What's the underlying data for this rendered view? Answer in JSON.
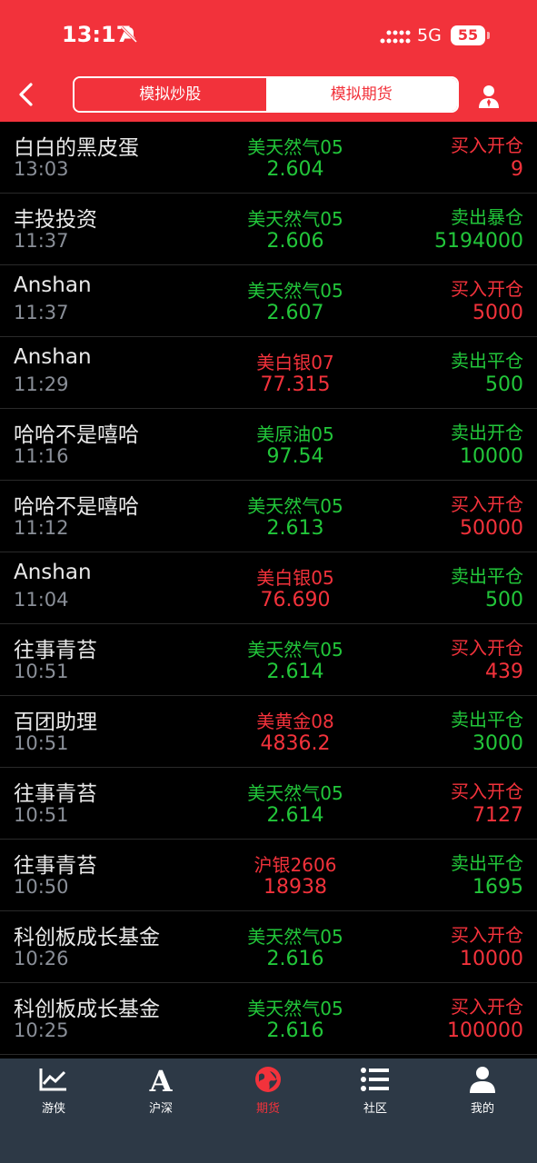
{
  "status": {
    "time": "13:17",
    "network": "5G",
    "battery": "55"
  },
  "header": {
    "tabs": [
      {
        "label": "模拟炒股"
      },
      {
        "label": "模拟期货"
      }
    ]
  },
  "rows": [
    {
      "name": "白白的黑皮蛋",
      "time": "13:03",
      "symbol": "美天然气05",
      "price": "2.604",
      "action": "买入开仓",
      "qty": "9",
      "symbol_color": "green",
      "action_color": "red"
    },
    {
      "name": "丰投投资",
      "time": "11:37",
      "symbol": "美天然气05",
      "price": "2.606",
      "action": "卖出暴仓",
      "qty": "5194000",
      "symbol_color": "green",
      "action_color": "green"
    },
    {
      "name": "Anshan",
      "time": "11:37",
      "symbol": "美天然气05",
      "price": "2.607",
      "action": "买入开仓",
      "qty": "5000",
      "symbol_color": "green",
      "action_color": "red"
    },
    {
      "name": "Anshan",
      "time": "11:29",
      "symbol": "美白银07",
      "price": "77.315",
      "action": "卖出平仓",
      "qty": "500",
      "symbol_color": "red",
      "action_color": "green"
    },
    {
      "name": "哈哈不是嘻哈",
      "time": "11:16",
      "symbol": "美原油05",
      "price": "97.54",
      "action": "卖出开仓",
      "qty": "10000",
      "symbol_color": "green",
      "action_color": "green"
    },
    {
      "name": "哈哈不是嘻哈",
      "time": "11:12",
      "symbol": "美天然气05",
      "price": "2.613",
      "action": "买入开仓",
      "qty": "50000",
      "symbol_color": "green",
      "action_color": "red"
    },
    {
      "name": "Anshan",
      "time": "11:04",
      "symbol": "美白银05",
      "price": "76.690",
      "action": "卖出平仓",
      "qty": "500",
      "symbol_color": "red",
      "action_color": "green"
    },
    {
      "name": "往事青苔",
      "time": "10:51",
      "symbol": "美天然气05",
      "price": "2.614",
      "action": "买入开仓",
      "qty": "439",
      "symbol_color": "green",
      "action_color": "red"
    },
    {
      "name": "百团助理",
      "time": "10:51",
      "symbol": "美黄金08",
      "price": "4836.2",
      "action": "卖出平仓",
      "qty": "3000",
      "symbol_color": "red",
      "action_color": "green"
    },
    {
      "name": "往事青苔",
      "time": "10:51",
      "symbol": "美天然气05",
      "price": "2.614",
      "action": "买入开仓",
      "qty": "7127",
      "symbol_color": "green",
      "action_color": "red"
    },
    {
      "name": "往事青苔",
      "time": "10:50",
      "symbol": "沪银2606",
      "price": "18938",
      "action": "卖出平仓",
      "qty": "1695",
      "symbol_color": "red",
      "action_color": "green"
    },
    {
      "name": "科创板成长基金",
      "time": "10:26",
      "symbol": "美天然气05",
      "price": "2.616",
      "action": "买入开仓",
      "qty": "10000",
      "symbol_color": "green",
      "action_color": "red"
    },
    {
      "name": "科创板成长基金",
      "time": "10:25",
      "symbol": "美天然气05",
      "price": "2.616",
      "action": "买入开仓",
      "qty": "100000",
      "symbol_color": "green",
      "action_color": "red"
    }
  ],
  "nav": [
    {
      "label": "游侠",
      "icon": "chart-icon"
    },
    {
      "label": "沪深",
      "icon": "letter-a-icon"
    },
    {
      "label": "期货",
      "icon": "globe-icon",
      "active": true
    },
    {
      "label": "社区",
      "icon": "list-icon"
    },
    {
      "label": "我的",
      "icon": "person-icon"
    }
  ],
  "colors": {
    "brand": "#f2323b",
    "green": "#22c63a",
    "nav_bg": "#2d3946"
  }
}
